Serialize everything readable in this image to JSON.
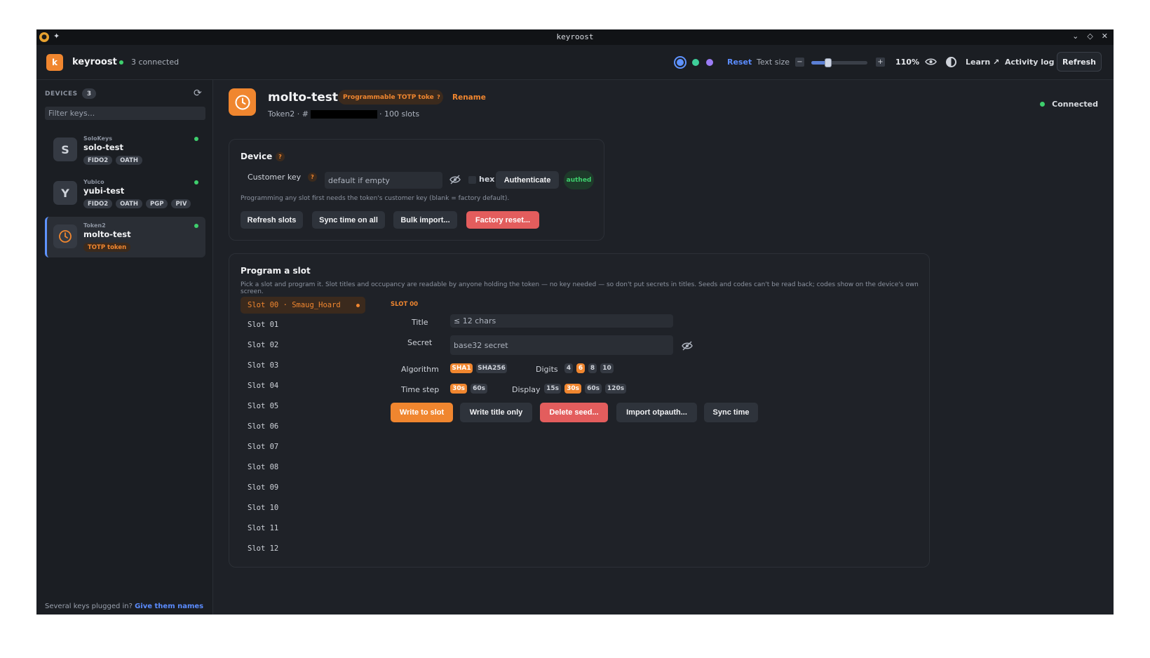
{
  "window": {
    "title": "keyroost"
  },
  "header": {
    "app_name": "keyroost",
    "logo_letter": "k",
    "connected_text": "3 connected",
    "reset_label": "Reset",
    "text_size_label": "Text size",
    "text_size_level": 0.3,
    "text_size_pct": "110%",
    "learn_label": "Learn ↗",
    "activity_label": "Activity log",
    "refresh_label": "Refresh",
    "theme_colors": [
      "#5f93ff",
      "#3ecf9a",
      "#9b7cf5"
    ]
  },
  "sidebar": {
    "devices_label": "DEVICES",
    "devices_count": "3",
    "filter_placeholder": "Filter keys...",
    "devices": [
      {
        "avatar": "S",
        "vendor": "SoloKeys",
        "name": "solo-test",
        "tags": [
          "FIDO2",
          "OATH"
        ]
      },
      {
        "avatar": "Y",
        "vendor": "Yubico",
        "name": "yubi-test",
        "tags": [
          "FIDO2",
          "OATH",
          "PGP",
          "PIV"
        ]
      },
      {
        "avatar": "",
        "vendor": "Token2",
        "name": "molto-test",
        "tags": [
          "TOTP token"
        ]
      }
    ],
    "footer_text": "Several keys plugged in?",
    "footer_link": "Give them names"
  },
  "token": {
    "title": "molto-test",
    "badge": "Programmable TOTP token",
    "help": "?",
    "rename_label": "Rename",
    "sub_prefix": "Token2 · #",
    "sub_suffix": "· 100 slots",
    "status": "Connected"
  },
  "device_card": {
    "title": "Device",
    "customer_key_label": "Customer key",
    "customer_key_placeholder": "default if empty",
    "hex_label": "hex",
    "authenticate_label": "Authenticate",
    "authed_label": "authed",
    "hint": "Programming any slot first needs the token's customer key (blank = factory default).",
    "buttons": {
      "refresh_slots": "Refresh slots",
      "sync_all": "Sync time on all",
      "bulk_import": "Bulk import...",
      "factory_reset": "Factory reset..."
    }
  },
  "program_card": {
    "title": "Program a slot",
    "hint": "Pick a slot and program it. Slot titles and occupancy are readable by anyone holding the token — no key needed — so don't put secrets in titles. Seeds and codes can't be read back; codes show on the device's own screen.",
    "slots": [
      "Slot 00 · Smaug_Hoard",
      "Slot 01",
      "Slot 02",
      "Slot 03",
      "Slot 04",
      "Slot 05",
      "Slot 06",
      "Slot 07",
      "Slot 08",
      "Slot 09",
      "Slot 10",
      "Slot 11",
      "Slot 12"
    ],
    "selected_slot_label": "SLOT 00",
    "title_label": "Title",
    "title_placeholder": "≤ 12 chars",
    "secret_label": "Secret",
    "secret_placeholder": "base32 secret",
    "algorithm_label": "Algorithm",
    "algorithms": [
      "SHA1",
      "SHA256"
    ],
    "algorithm_selected": "SHA1",
    "digits_label": "Digits",
    "digits": [
      "4",
      "6",
      "8",
      "10"
    ],
    "digits_selected": "6",
    "timestep_label": "Time step",
    "timesteps": [
      "30s",
      "60s"
    ],
    "timestep_selected": "30s",
    "display_label": "Display",
    "displays": [
      "15s",
      "30s",
      "60s",
      "120s"
    ],
    "display_selected": "30s",
    "buttons": {
      "write": "Write to slot",
      "write_title": "Write title only",
      "delete_seed": "Delete seed...",
      "import": "Import otpauth...",
      "sync": "Sync time"
    }
  }
}
